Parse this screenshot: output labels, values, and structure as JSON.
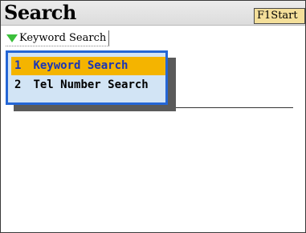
{
  "header": {
    "title": "Search",
    "f1_button_label": "F1Start"
  },
  "search_type": {
    "selected": "Keyword Search"
  },
  "menu": {
    "items": [
      {
        "number": "1",
        "label": "Keyword Search"
      },
      {
        "number": "2",
        "label": "Tel Number Search"
      }
    ]
  },
  "colors": {
    "accent_blue": "#2466d6",
    "selection_orange": "#f4b400",
    "popup_bg": "#d2e4f5",
    "dropdown_triangle": "#3bbf3b",
    "button_bg": "#f4df9a"
  },
  "icons": {
    "dropdown": "triangle-down-icon"
  }
}
